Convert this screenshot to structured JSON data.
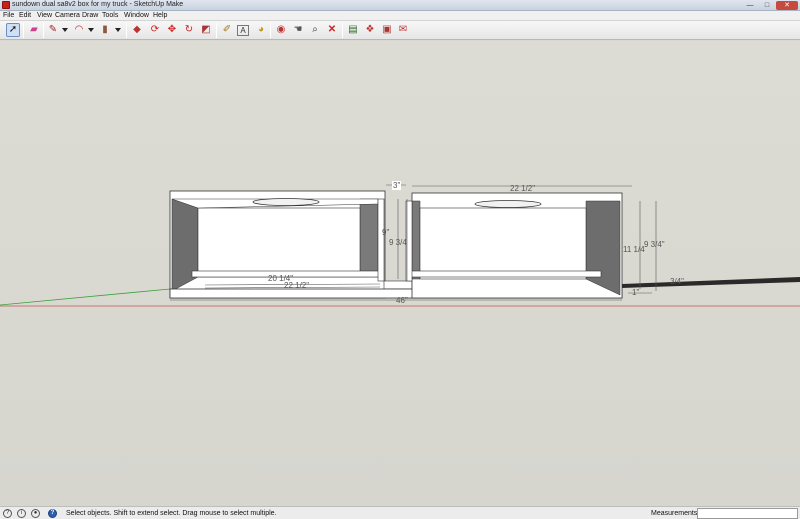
{
  "window": {
    "title": "sundown dual sa8v2 box for my truck - SketchUp Make",
    "minimize_label": "—",
    "maximize_label": "□",
    "close_label": "✕"
  },
  "menu": {
    "items": [
      "File",
      "Edit",
      "View",
      "Camera",
      "Draw",
      "Tools",
      "Window",
      "Help"
    ]
  },
  "toolbar": {
    "tools": [
      {
        "name": "select-tool",
        "icon": "arrow-icon",
        "glyph": "➚"
      },
      {
        "name": "eraser-tool",
        "icon": "eraser-icon",
        "glyph": "▰"
      },
      {
        "name": "line-tool",
        "icon": "pencil-icon",
        "glyph": "✎"
      },
      {
        "name": "arc-tool",
        "icon": "arc-icon",
        "glyph": "◠"
      },
      {
        "name": "rectangle-tool",
        "icon": "rectangle-icon",
        "glyph": "▮"
      },
      {
        "name": "pushpull-tool",
        "icon": "pushpull-icon",
        "glyph": "◆"
      },
      {
        "name": "followme-tool",
        "icon": "followme-icon",
        "glyph": "⟳"
      },
      {
        "name": "move-tool",
        "icon": "move-icon",
        "glyph": "✥"
      },
      {
        "name": "rotate-tool",
        "icon": "rotate-icon",
        "glyph": "↻"
      },
      {
        "name": "scale-tool",
        "icon": "scale-icon",
        "glyph": "◩"
      },
      {
        "name": "tape-measure-tool",
        "icon": "tape-icon",
        "glyph": "✐"
      },
      {
        "name": "text-tool",
        "icon": "text-icon",
        "glyph": "A"
      },
      {
        "name": "paint-bucket-tool",
        "icon": "paint-bucket-icon",
        "glyph": "◕"
      },
      {
        "name": "orbit-tool",
        "icon": "orbit-icon",
        "glyph": "◉"
      },
      {
        "name": "pan-tool",
        "icon": "hand-icon",
        "glyph": "☚"
      },
      {
        "name": "zoom-tool",
        "icon": "magnifier-icon",
        "glyph": "⌕"
      },
      {
        "name": "zoom-extents-tool",
        "icon": "zoom-extents-icon",
        "glyph": "✕"
      },
      {
        "name": "warehouse-tool",
        "icon": "warehouse-icon",
        "glyph": "▤"
      },
      {
        "name": "components-tool",
        "icon": "components-icon",
        "glyph": "❖"
      },
      {
        "name": "extension-tool",
        "icon": "extension-icon",
        "glyph": "▣"
      },
      {
        "name": "share-tool",
        "icon": "share-icon",
        "glyph": "✉"
      }
    ]
  },
  "model": {
    "dimensions": {
      "top_width": "22 1/2\"",
      "chamber_port": "3\"",
      "height_left": "9\"",
      "height_inner": "9 3/4",
      "height_outer": "11 1/4",
      "height_outer2": "9 3/4\"",
      "inner_width": "20 1/4\"",
      "inner_width2": "22 1/2\"",
      "overall_width": "46\"",
      "small_dim": "3/4\"",
      "tiny_dim": "1\""
    }
  },
  "status": {
    "text": "Select objects. Shift to extend select. Drag mouse to select multiple.",
    "measurements_label": "Measurements",
    "measurements_value": ""
  },
  "colors": {
    "canvas": "#d6d6cf",
    "box_face": "#ffffff",
    "box_shadow": "#6d6d6d",
    "axis_red": "#c0504d",
    "axis_green": "#3aa13a",
    "dimension": "#5a5a5a"
  }
}
